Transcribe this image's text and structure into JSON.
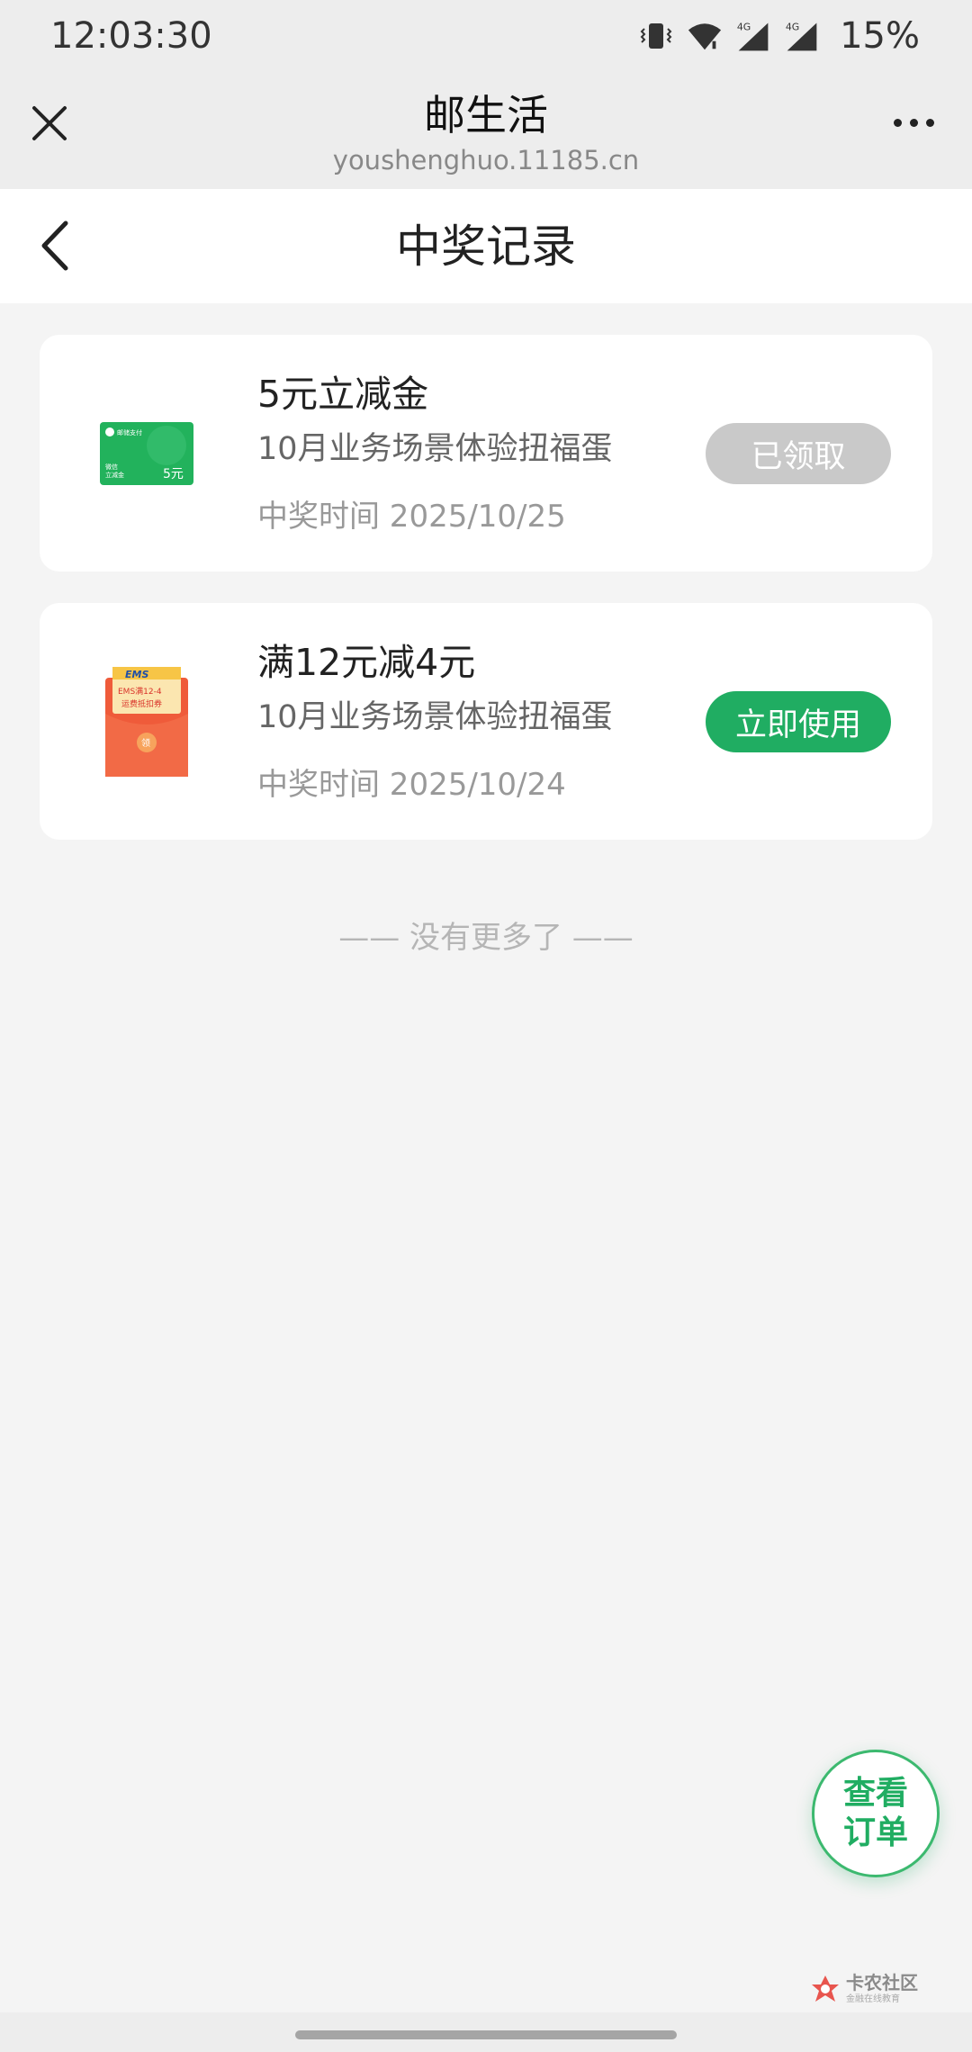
{
  "status_bar": {
    "time": "12:03:30",
    "icons": [
      "vibrate-icon",
      "wifi-icon",
      "signal-4g-icon",
      "signal-4g-icon"
    ],
    "network_label": "4G",
    "battery": "15%"
  },
  "browser": {
    "title": "邮生活",
    "url": "youshenghuo.11185.cn"
  },
  "page": {
    "title": "中奖记录"
  },
  "records": [
    {
      "title": "5元立减金",
      "subtitle": "10月业务场景体验扭福蛋",
      "date": "中奖时间 2025/10/25",
      "button": "已领取",
      "thumb": {
        "brand": "邮储支付",
        "line1": "微信",
        "line2": "立减金",
        "amount": "5元"
      }
    },
    {
      "title": "满12元减4元",
      "subtitle": "10月业务场景体验扭福蛋",
      "date": "中奖时间 2025/10/24",
      "button": "立即使用",
      "thumb": {
        "brand": "EMS",
        "line1": "EMS满12-4",
        "line2": "运费抵扣券",
        "badge": "领"
      }
    }
  ],
  "no_more": "—— 没有更多了 ——",
  "float_button": {
    "line1": "查看",
    "line2": "订单"
  },
  "watermark": {
    "title": "卡农社区",
    "sub": "金融在线教育"
  },
  "colors": {
    "accent_green": "#20ad62",
    "claimed_gray": "#c9c9c9",
    "background": "#f4f4f4"
  }
}
